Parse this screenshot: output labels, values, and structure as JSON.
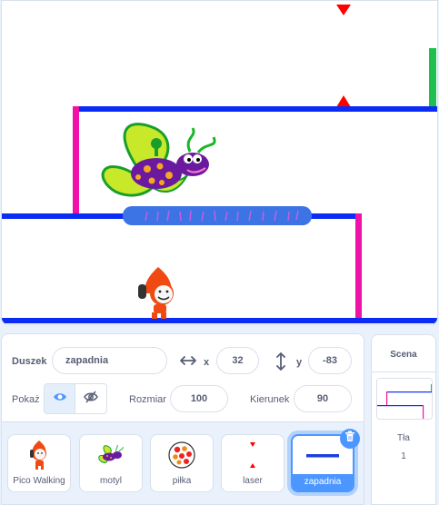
{
  "sprite_info": {
    "sprite_label": "Duszek",
    "sprite_name": "zapadnia",
    "x_label": "x",
    "x_value": "32",
    "y_label": "y",
    "y_value": "-83",
    "show_label": "Pokaż",
    "size_label": "Rozmiar",
    "size_value": "100",
    "direction_label": "Kierunek",
    "direction_value": "90"
  },
  "sprites": [
    {
      "name": "Pico Walking",
      "icon": "pico-walking-icon"
    },
    {
      "name": "motyl",
      "icon": "butterfly-icon"
    },
    {
      "name": "piłka",
      "icon": "ball-icon"
    },
    {
      "name": "laser",
      "icon": "laser-icon"
    },
    {
      "name": "zapadnia",
      "icon": "trapdoor-icon",
      "selected": true
    }
  ],
  "stage_panel": {
    "title": "Scena",
    "backdrops_label": "Tła",
    "backdrops_count": "1"
  },
  "colors": {
    "accent": "#4c97ff",
    "floor_blue": "#0000ff",
    "wall_magenta": "#ff00aa",
    "exit_green": "#00cc44",
    "laser_red": "#ff0000"
  }
}
